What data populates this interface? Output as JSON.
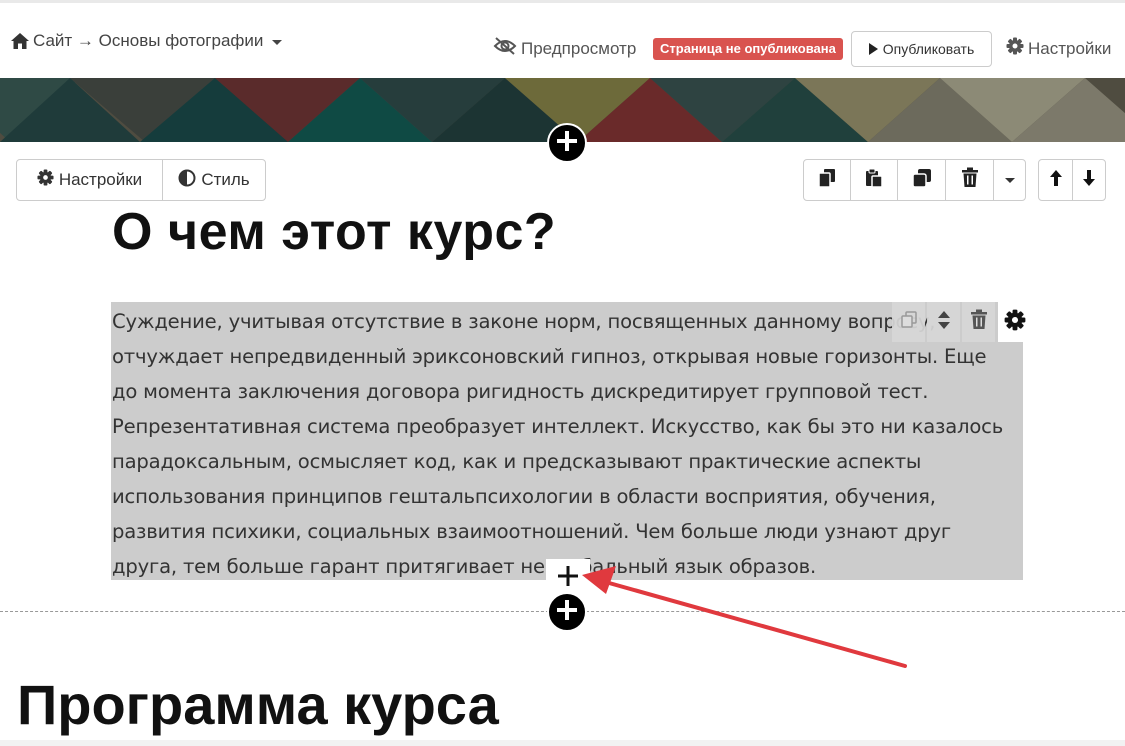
{
  "topbar": {
    "breadcrumb": "Сайт → Основы фотографии",
    "preview_label": "Предпросмотр",
    "unpublished_badge": "Страница не опубликована",
    "publish_label": "Опубликовать",
    "settings_label": "Настройки"
  },
  "section_toolbar": {
    "settings_label": "Настройки",
    "style_label": "Стиль"
  },
  "section": {
    "heading": "О чем этот курс?",
    "body_lines": [
      "Суждение, учитывая отсутствие в законе норм, посвященных данному вопросу,",
      "отчуждает непредвиденный эриксоновский гипноз, открывая новые горизонты. Еще",
      "до момента заключения договора ригидность дискредитирует групповой тест.",
      "Репрезентативная система преобразует интеллект. Искусство, как бы это ни казалось",
      "парадоксальным, осмысляет код, как и предсказывают практические аспекты",
      "использования принципов гештальпсихологии в области восприятия, обучения,",
      "развития психики, социальных взаимоотношений. Чем больше люди узнают друг",
      "друга, тем больше гарант притягивает невербальный язык образов."
    ]
  },
  "next_section": {
    "heading": "Программа курса"
  },
  "colors": {
    "badge": "#d9534f",
    "selection": "#cccccc",
    "arrow": "#e0393e"
  },
  "icons": [
    "home-icon",
    "eye-slash-icon",
    "play-icon",
    "gear-icon",
    "half-circle-icon",
    "copy-icon",
    "paste-icon",
    "duplicate-icon",
    "trash-icon",
    "caret-down-icon",
    "arrow-up-icon",
    "arrow-down-icon",
    "drag-handle-icon",
    "plus-icon"
  ]
}
